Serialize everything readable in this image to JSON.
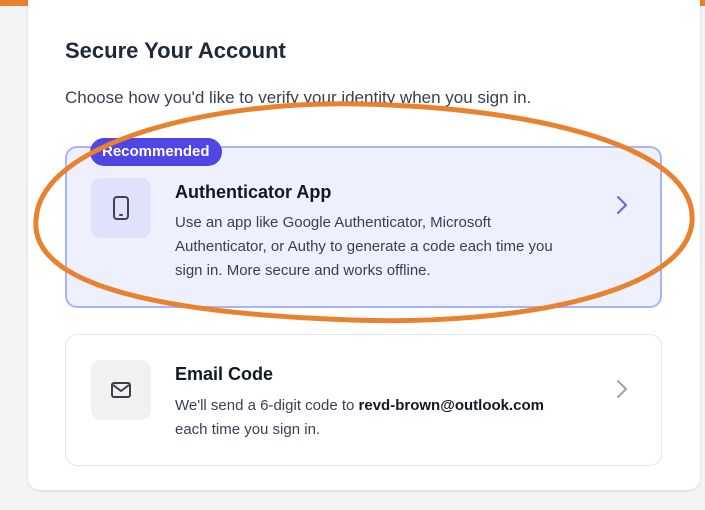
{
  "header": {
    "title": "Secure Your Account",
    "subtitle": "Choose how you'd like to verify your identity when you sign in."
  },
  "options": [
    {
      "badge": "Recommended",
      "title": "Authenticator App",
      "description": "Use an app like Google Authenticator, Microsoft Authenticator, or Authy to generate a code each time you sign in. More secure and works offline.",
      "icon": "smartphone-icon"
    },
    {
      "title": "Email Code",
      "description_prefix": "We'll send a 6-digit code to ",
      "email": "revd-brown@outlook.com",
      "description_suffix": " each time you sign in.",
      "icon": "mail-icon"
    }
  ],
  "colors": {
    "accent": "#4f46e5",
    "highlight_bg": "#eef0fd",
    "annotation_orange": "#e8822f"
  }
}
